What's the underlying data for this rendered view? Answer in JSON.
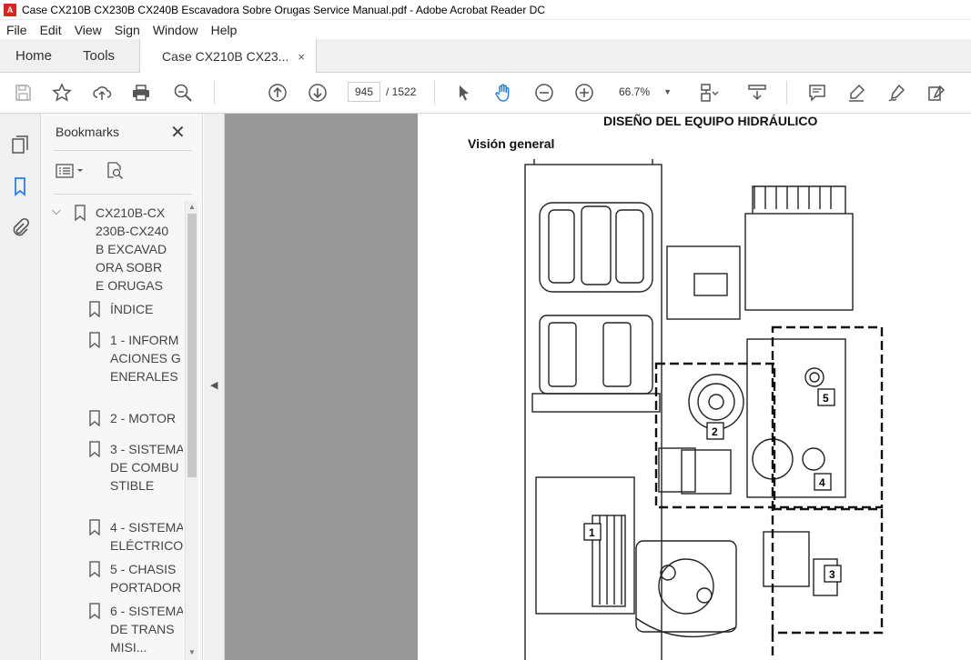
{
  "window": {
    "title": "Case CX210B CX230B CX240B Escavadora Sobre Orugas Service Manual.pdf - Adobe Acrobat Reader DC",
    "app_icon": "acrobat-icon"
  },
  "menu": [
    "File",
    "Edit",
    "View",
    "Sign",
    "Window",
    "Help"
  ],
  "tabs": {
    "home": "Home",
    "tools": "Tools",
    "document": "Case CX210B CX23...",
    "close_glyph": "×"
  },
  "toolbar": {
    "current_page": "945",
    "total_pages": "/ 1522",
    "zoom": "66.7%",
    "icons": [
      "save-icon",
      "star-icon",
      "upload-icon",
      "print-icon",
      "find-zoom-icon",
      "page-up-icon",
      "page-down-icon",
      "select-pointer-icon",
      "hand-tool-icon",
      "zoom-out-icon",
      "zoom-in-icon",
      "page-display-icon",
      "scroll-mode-icon",
      "comment-icon",
      "highlight-icon",
      "sign-icon",
      "fill-sign-icon"
    ]
  },
  "bookmarks": {
    "title": "Bookmarks",
    "close_glyph": "✕",
    "items": [
      {
        "label": "CX210B-CX230B-CX240B EXCAVADORA SOBRE ORUGAS"
      },
      {
        "label": "ÍNDICE"
      },
      {
        "label": "1 - INFORMACIONES GENERALES"
      },
      {
        "label": "2 - MOTOR"
      },
      {
        "label": "3 - SISTEMA DE COMBUSTIBLE"
      },
      {
        "label": "4 - SISTEMA ELÉCTRICO"
      },
      {
        "label": "5 - CHASIS PORTADOR"
      },
      {
        "label": "6 - SISTEMA DE TRANSMISI..."
      }
    ]
  },
  "document": {
    "heading": "DISEÑO DEL EQUIPO HIDRÁULICO",
    "subheading": "Visión general",
    "callouts": [
      "1",
      "2",
      "3",
      "4",
      "5"
    ]
  },
  "colors": {
    "accent": "#2680eb",
    "canvas_gray": "#999999",
    "acrobat_red": "#d9261c"
  }
}
